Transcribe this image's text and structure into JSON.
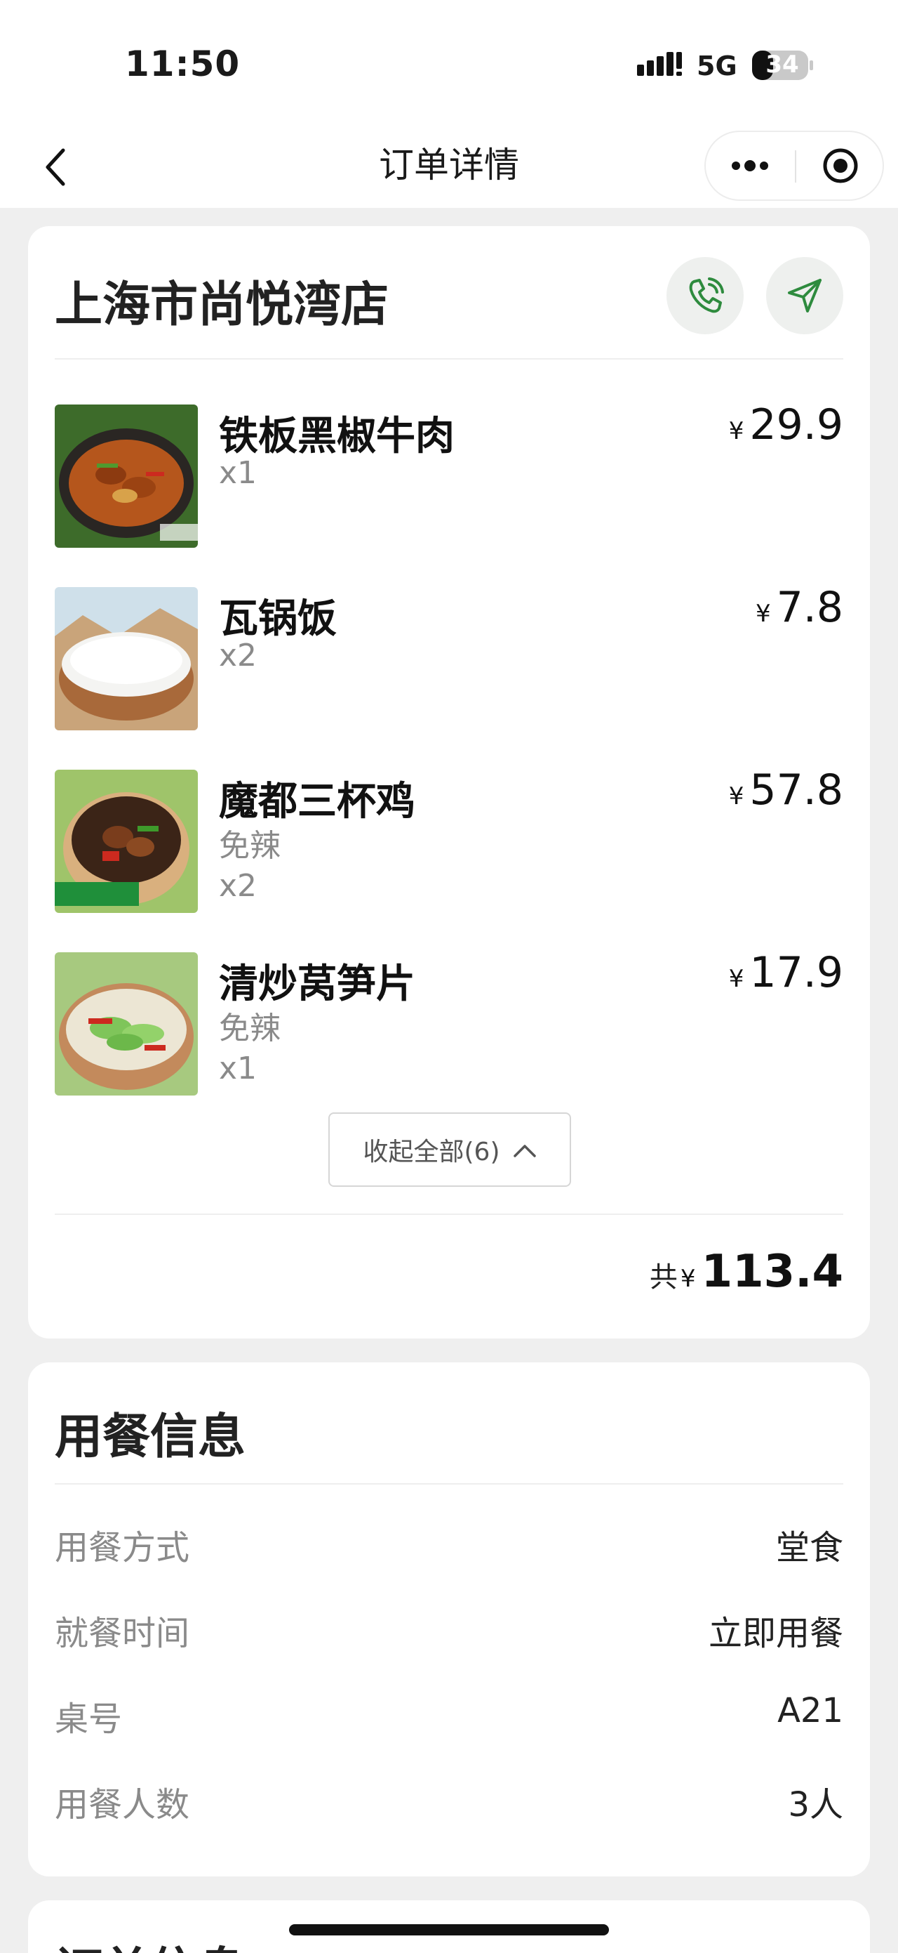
{
  "status_bar": {
    "time": "11:50",
    "network": "5G",
    "battery": "34"
  },
  "nav": {
    "title": "订单详情",
    "back_icon": "chevron-left-icon",
    "more_icon": "more-dots-icon",
    "close_icon": "target-icon"
  },
  "store": {
    "name": "上海市尚悦湾店",
    "call_icon": "phone-icon",
    "navigate_icon": "navigation-arrow-icon"
  },
  "items": [
    {
      "name": "铁板黑椒牛肉",
      "spec": "",
      "qty": "x1",
      "currency": "¥",
      "price": "29.9"
    },
    {
      "name": "瓦锅饭",
      "spec": "",
      "qty": "x2",
      "currency": "¥",
      "price": "7.8"
    },
    {
      "name": "魔都三杯鸡",
      "spec": "免辣",
      "qty": "x2",
      "currency": "¥",
      "price": "57.8"
    },
    {
      "name": "清炒莴笋片",
      "spec": "免辣",
      "qty": "x1",
      "currency": "¥",
      "price": "17.9"
    }
  ],
  "collapse_label": "收起全部(6)",
  "total": {
    "label": "共",
    "currency": "¥",
    "amount": "113.4"
  },
  "dine_info": {
    "title": "用餐信息",
    "rows": [
      {
        "key": "用餐方式",
        "value": "堂食"
      },
      {
        "key": "就餐时间",
        "value": "立即用餐"
      },
      {
        "key": "桌号",
        "value": "A21"
      },
      {
        "key": "用餐人数",
        "value": "3人"
      }
    ]
  },
  "order_info": {
    "title": "订单信息"
  },
  "colors": {
    "accent_green": "#2e8b3e",
    "background": "#efefef",
    "card": "#ffffff"
  }
}
